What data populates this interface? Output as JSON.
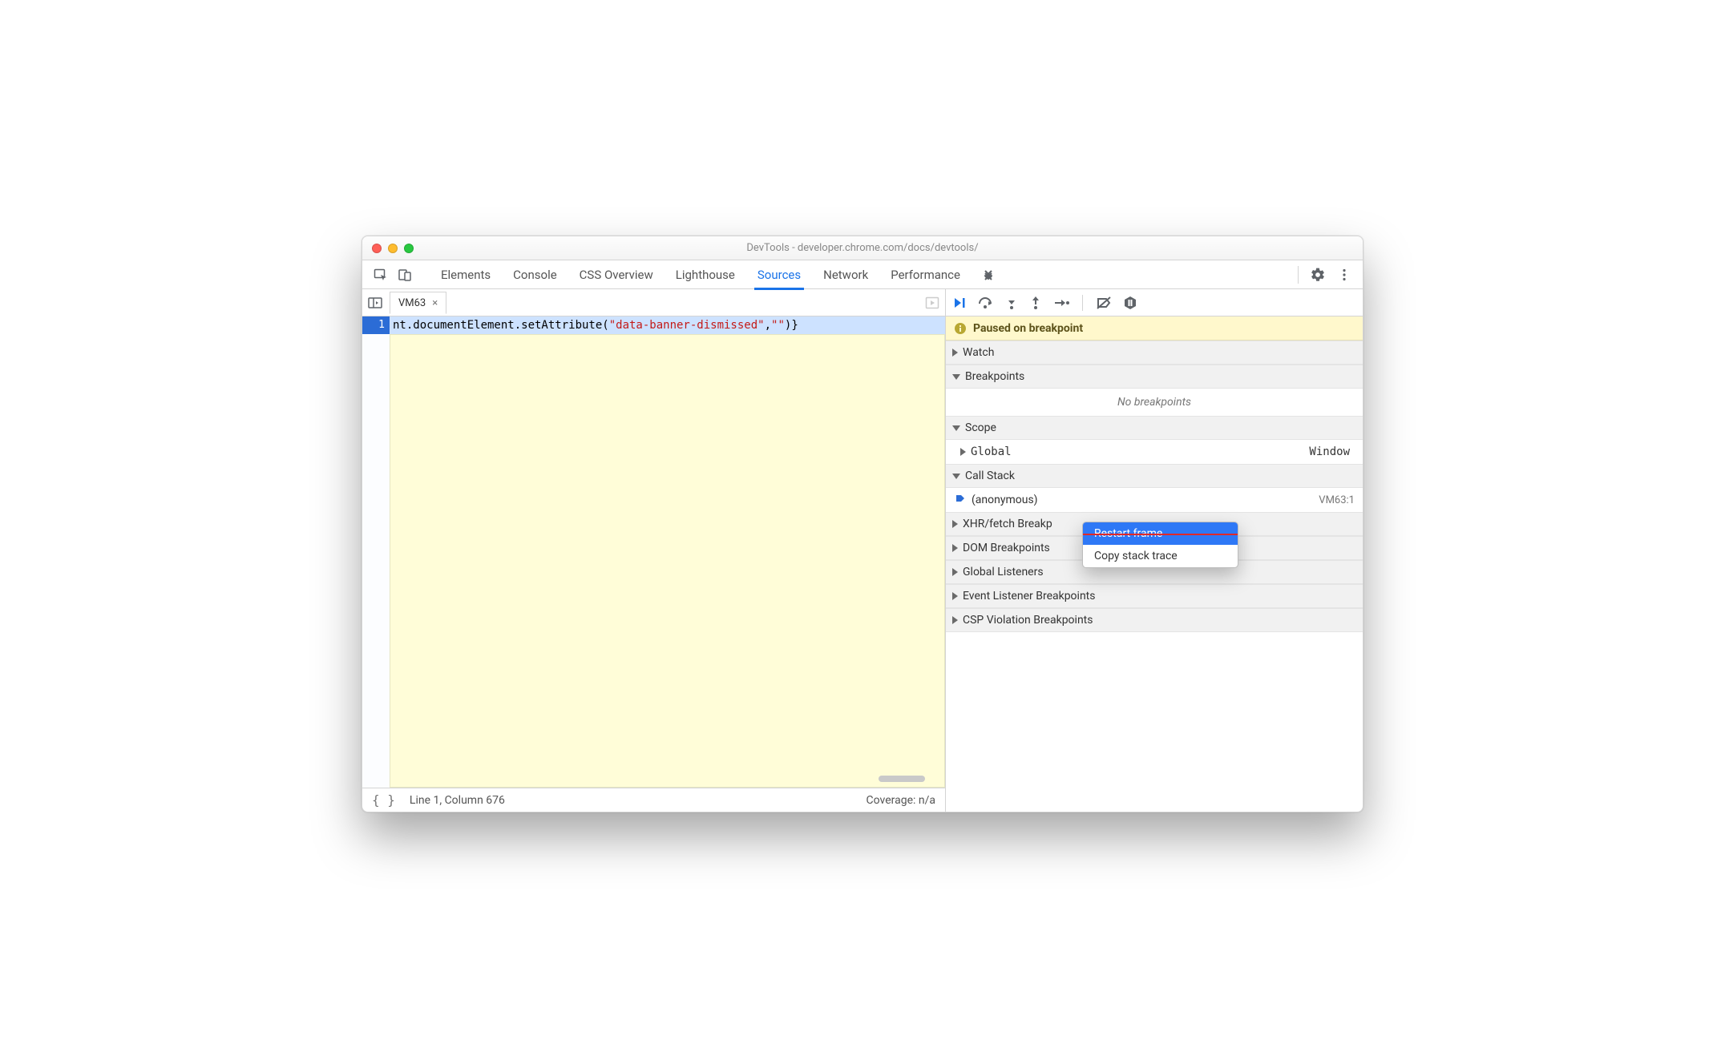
{
  "window_title": "DevTools - developer.chrome.com/docs/devtools/",
  "main_tabs": {
    "elements": "Elements",
    "console": "Console",
    "css_overview": "CSS Overview",
    "lighthouse": "Lighthouse",
    "sources": "Sources",
    "network": "Network",
    "performance": "Performance"
  },
  "source_tab": {
    "name": "VM63"
  },
  "code": {
    "line_number": "1",
    "prefix": "nt.documentElement.setAttribute(",
    "string_arg": "\"data-banner-dismissed\"",
    "mid": ",",
    "string_arg2": "\"\"",
    "suffix": ")}"
  },
  "status": {
    "linecol": "Line 1, Column 676",
    "coverage": "Coverage: n/a"
  },
  "paused_label": "Paused on breakpoint",
  "sections": {
    "watch": "Watch",
    "breakpoints": "Breakpoints",
    "no_breakpoints": "No breakpoints",
    "scope": "Scope",
    "scope_global": "Global",
    "scope_global_val": "Window",
    "callstack": "Call Stack",
    "frame_name": "(anonymous)",
    "frame_loc": "VM63:1",
    "xhr": "XHR/fetch Breakp",
    "dom": "DOM Breakpoints",
    "global_listeners": "Global Listeners",
    "event_listener": "Event Listener Breakpoints",
    "csp": "CSP Violation Breakpoints"
  },
  "context_menu": {
    "restart": "Restart frame",
    "copy_stack": "Copy stack trace"
  }
}
